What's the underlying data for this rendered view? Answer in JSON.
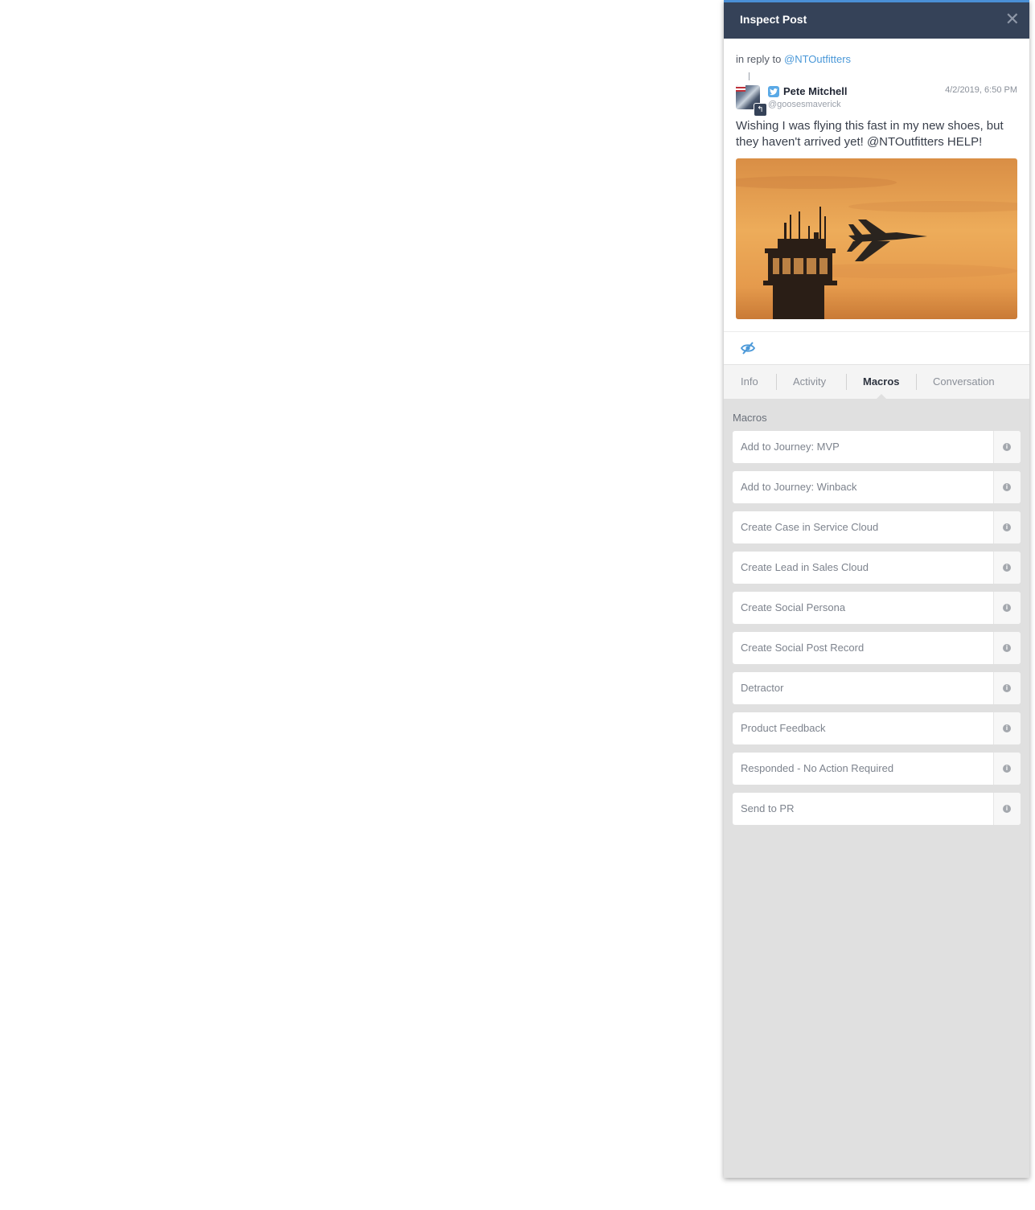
{
  "header": {
    "title": "Inspect Post",
    "close_icon": "close-icon"
  },
  "post": {
    "reply_prefix": "in reply to",
    "reply_handle": "@NTOutfitters",
    "author_name": "Pete Mitchell",
    "author_handle": "@goosesmaverick",
    "network_icon": "twitter-icon",
    "timestamp": "4/2/2019, 6:50 PM",
    "text": "Wishing I was flying this fast in my new shoes, but they haven't arrived yet! @NTOutfitters HELP!",
    "image_icon": "photo-jet-over-control-tower"
  },
  "actions": {
    "hide_icon": "eye-slash-icon"
  },
  "tabs": [
    {
      "label": "Info",
      "active": false
    },
    {
      "label": "Activity",
      "active": false
    },
    {
      "label": "Macros",
      "active": true
    },
    {
      "label": "Conversation",
      "active": false
    }
  ],
  "macros": {
    "heading": "Macros",
    "items": [
      {
        "label": "Add to Journey: MVP"
      },
      {
        "label": "Add to Journey: Winback"
      },
      {
        "label": "Create Case in Service Cloud"
      },
      {
        "label": "Create Lead in Sales Cloud"
      },
      {
        "label": "Create Social Persona"
      },
      {
        "label": "Create Social Post Record"
      },
      {
        "label": "Detractor"
      },
      {
        "label": "Product Feedback"
      },
      {
        "label": "Responded - No Action Required"
      },
      {
        "label": "Send to PR"
      }
    ]
  },
  "colors": {
    "header_bg": "#354258",
    "accent": "#4a98d8",
    "panel_bg": "#e0e0e0"
  }
}
